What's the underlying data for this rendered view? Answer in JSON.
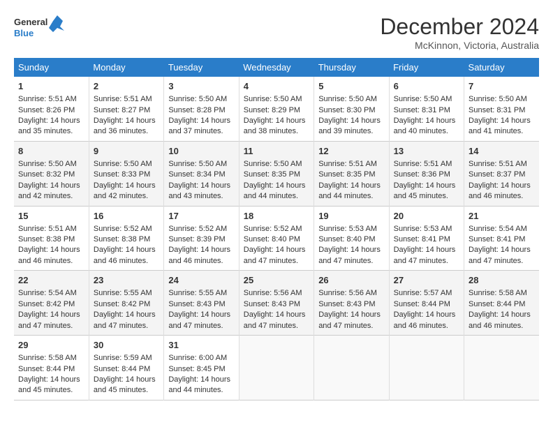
{
  "header": {
    "logo_line1": "General",
    "logo_line2": "Blue",
    "month": "December 2024",
    "location": "McKinnon, Victoria, Australia"
  },
  "days_of_week": [
    "Sunday",
    "Monday",
    "Tuesday",
    "Wednesday",
    "Thursday",
    "Friday",
    "Saturday"
  ],
  "weeks": [
    [
      {
        "day": 1,
        "sunrise": "5:51 AM",
        "sunset": "8:26 PM",
        "daylight": "14 hours and 35 minutes."
      },
      {
        "day": 2,
        "sunrise": "5:51 AM",
        "sunset": "8:27 PM",
        "daylight": "14 hours and 36 minutes."
      },
      {
        "day": 3,
        "sunrise": "5:50 AM",
        "sunset": "8:28 PM",
        "daylight": "14 hours and 37 minutes."
      },
      {
        "day": 4,
        "sunrise": "5:50 AM",
        "sunset": "8:29 PM",
        "daylight": "14 hours and 38 minutes."
      },
      {
        "day": 5,
        "sunrise": "5:50 AM",
        "sunset": "8:30 PM",
        "daylight": "14 hours and 39 minutes."
      },
      {
        "day": 6,
        "sunrise": "5:50 AM",
        "sunset": "8:31 PM",
        "daylight": "14 hours and 40 minutes."
      },
      {
        "day": 7,
        "sunrise": "5:50 AM",
        "sunset": "8:31 PM",
        "daylight": "14 hours and 41 minutes."
      }
    ],
    [
      {
        "day": 8,
        "sunrise": "5:50 AM",
        "sunset": "8:32 PM",
        "daylight": "14 hours and 42 minutes."
      },
      {
        "day": 9,
        "sunrise": "5:50 AM",
        "sunset": "8:33 PM",
        "daylight": "14 hours and 42 minutes."
      },
      {
        "day": 10,
        "sunrise": "5:50 AM",
        "sunset": "8:34 PM",
        "daylight": "14 hours and 43 minutes."
      },
      {
        "day": 11,
        "sunrise": "5:50 AM",
        "sunset": "8:35 PM",
        "daylight": "14 hours and 44 minutes."
      },
      {
        "day": 12,
        "sunrise": "5:51 AM",
        "sunset": "8:35 PM",
        "daylight": "14 hours and 44 minutes."
      },
      {
        "day": 13,
        "sunrise": "5:51 AM",
        "sunset": "8:36 PM",
        "daylight": "14 hours and 45 minutes."
      },
      {
        "day": 14,
        "sunrise": "5:51 AM",
        "sunset": "8:37 PM",
        "daylight": "14 hours and 46 minutes."
      }
    ],
    [
      {
        "day": 15,
        "sunrise": "5:51 AM",
        "sunset": "8:38 PM",
        "daylight": "14 hours and 46 minutes."
      },
      {
        "day": 16,
        "sunrise": "5:52 AM",
        "sunset": "8:38 PM",
        "daylight": "14 hours and 46 minutes."
      },
      {
        "day": 17,
        "sunrise": "5:52 AM",
        "sunset": "8:39 PM",
        "daylight": "14 hours and 46 minutes."
      },
      {
        "day": 18,
        "sunrise": "5:52 AM",
        "sunset": "8:40 PM",
        "daylight": "14 hours and 47 minutes."
      },
      {
        "day": 19,
        "sunrise": "5:53 AM",
        "sunset": "8:40 PM",
        "daylight": "14 hours and 47 minutes."
      },
      {
        "day": 20,
        "sunrise": "5:53 AM",
        "sunset": "8:41 PM",
        "daylight": "14 hours and 47 minutes."
      },
      {
        "day": 21,
        "sunrise": "5:54 AM",
        "sunset": "8:41 PM",
        "daylight": "14 hours and 47 minutes."
      }
    ],
    [
      {
        "day": 22,
        "sunrise": "5:54 AM",
        "sunset": "8:42 PM",
        "daylight": "14 hours and 47 minutes."
      },
      {
        "day": 23,
        "sunrise": "5:55 AM",
        "sunset": "8:42 PM",
        "daylight": "14 hours and 47 minutes."
      },
      {
        "day": 24,
        "sunrise": "5:55 AM",
        "sunset": "8:43 PM",
        "daylight": "14 hours and 47 minutes."
      },
      {
        "day": 25,
        "sunrise": "5:56 AM",
        "sunset": "8:43 PM",
        "daylight": "14 hours and 47 minutes."
      },
      {
        "day": 26,
        "sunrise": "5:56 AM",
        "sunset": "8:43 PM",
        "daylight": "14 hours and 47 minutes."
      },
      {
        "day": 27,
        "sunrise": "5:57 AM",
        "sunset": "8:44 PM",
        "daylight": "14 hours and 46 minutes."
      },
      {
        "day": 28,
        "sunrise": "5:58 AM",
        "sunset": "8:44 PM",
        "daylight": "14 hours and 46 minutes."
      }
    ],
    [
      {
        "day": 29,
        "sunrise": "5:58 AM",
        "sunset": "8:44 PM",
        "daylight": "14 hours and 45 minutes."
      },
      {
        "day": 30,
        "sunrise": "5:59 AM",
        "sunset": "8:44 PM",
        "daylight": "14 hours and 45 minutes."
      },
      {
        "day": 31,
        "sunrise": "6:00 AM",
        "sunset": "8:45 PM",
        "daylight": "14 hours and 44 minutes."
      },
      null,
      null,
      null,
      null
    ]
  ]
}
